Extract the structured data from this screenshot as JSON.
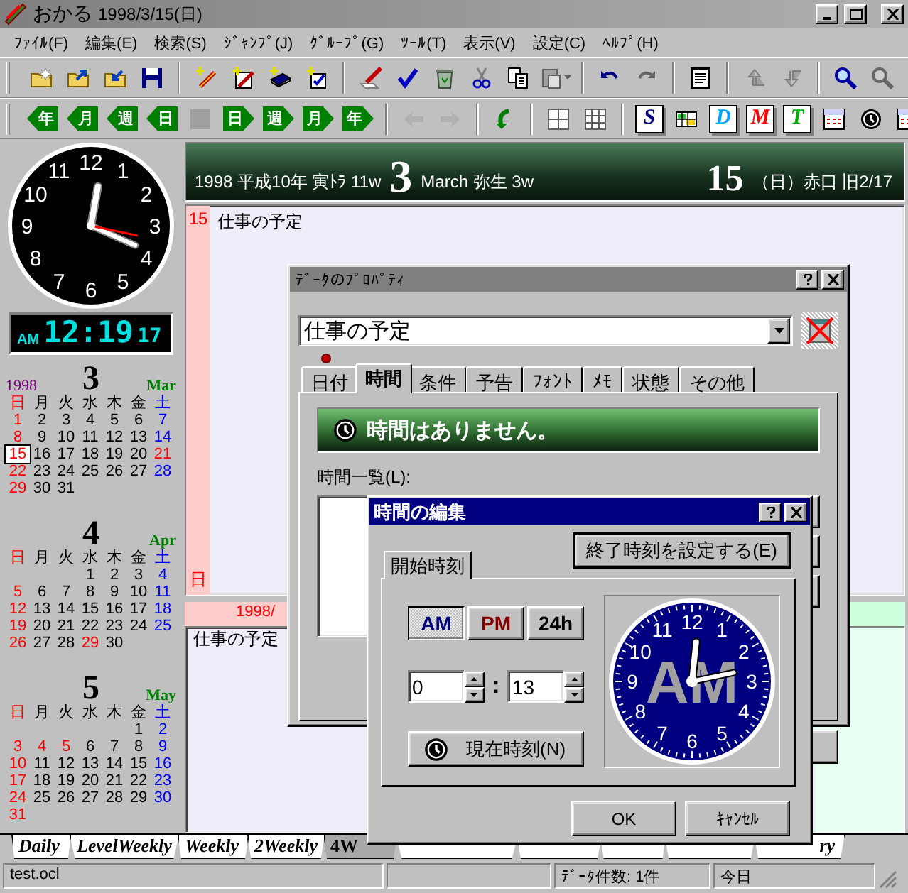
{
  "window": {
    "app_name": "おかる",
    "title_date": "1998/3/15(日)"
  },
  "menu": [
    "ﾌｧｲﾙ(F)",
    "編集(E)",
    "検索(S)",
    "ｼﾞｬﾝﾌﾟ(J)",
    "ｸﾞﾙｰﾌﾟ(G)",
    "ﾂｰﾙ(T)",
    "表示(V)",
    "設定(C)",
    "ﾍﾙﾌﾟ(H)"
  ],
  "toolbar_1": [
    [
      {
        "kind": "folder-new",
        "disabled": false
      },
      {
        "kind": "folder-open",
        "disabled": false
      },
      {
        "kind": "folder-save",
        "disabled": false
      },
      {
        "kind": "disk",
        "disabled": false
      }
    ],
    [
      {
        "kind": "new-pen",
        "disabled": false
      },
      {
        "kind": "new-edit",
        "disabled": false
      },
      {
        "kind": "new-book",
        "disabled": false
      },
      {
        "kind": "new-check",
        "disabled": false
      }
    ],
    [
      {
        "kind": "pen",
        "disabled": false
      },
      {
        "kind": "check",
        "disabled": false
      },
      {
        "kind": "trash",
        "disabled": false
      },
      {
        "kind": "scissors",
        "disabled": false
      },
      {
        "kind": "copy",
        "disabled": false
      },
      {
        "kind": "paste",
        "disabled": true
      }
    ],
    [
      {
        "kind": "undo",
        "disabled": false
      },
      {
        "kind": "redo",
        "disabled": true
      }
    ],
    [
      {
        "kind": "note",
        "disabled": false
      }
    ],
    [
      {
        "kind": "up",
        "disabled": true
      },
      {
        "kind": "down",
        "disabled": true
      }
    ],
    [
      {
        "kind": "search",
        "disabled": false
      },
      {
        "kind": "search",
        "disabled": true
      }
    ]
  ],
  "toolbar_2": [
    [
      {
        "kind": "prev",
        "label": "年",
        "disabled": false
      },
      {
        "kind": "prev",
        "label": "月",
        "disabled": false
      },
      {
        "kind": "prev",
        "label": "週",
        "disabled": false
      },
      {
        "kind": "prev",
        "label": "日",
        "disabled": false
      },
      {
        "kind": "stop",
        "disabled": true
      },
      {
        "kind": "next",
        "label": "日",
        "disabled": false
      },
      {
        "kind": "next",
        "label": "週",
        "disabled": false
      },
      {
        "kind": "next",
        "label": "月",
        "disabled": false
      },
      {
        "kind": "next",
        "label": "年",
        "disabled": false
      }
    ],
    [
      {
        "kind": "back",
        "disabled": true
      },
      {
        "kind": "forward",
        "disabled": true
      }
    ],
    [
      {
        "kind": "refresh",
        "disabled": false
      }
    ],
    [
      {
        "kind": "grid4",
        "disabled": false
      },
      {
        "kind": "grid9",
        "disabled": false
      }
    ],
    [
      {
        "kind": "letter",
        "label": "S",
        "color": "#000080",
        "disabled": false
      },
      {
        "kind": "table",
        "disabled": false
      },
      {
        "kind": "letter",
        "label": "D",
        "color": "#00a0ff",
        "disabled": false
      },
      {
        "kind": "letter",
        "label": "M",
        "color": "#ff0000",
        "disabled": false
      },
      {
        "kind": "letter",
        "label": "T",
        "color": "#00b000",
        "disabled": false
      },
      {
        "kind": "calendar",
        "disabled": false
      },
      {
        "kind": "clock",
        "disabled": false
      },
      {
        "kind": "calendar",
        "disabled": false
      }
    ]
  ],
  "clock": {
    "dial": [
      "12",
      "11",
      "1",
      "10",
      "2",
      "9",
      "3",
      "8",
      "4",
      "7",
      "5",
      "6"
    ],
    "meridiem": "AM",
    "time": "12:19",
    "seconds": "17"
  },
  "calendars": [
    {
      "year": "1998",
      "month": "3",
      "month_abbr": "Mar",
      "weekdays": [
        "日",
        "月",
        "火",
        "水",
        "木",
        "金",
        "土"
      ],
      "weeks": [
        [
          {
            "t": "1",
            "kind": "sunday",
            "selected": false
          },
          {
            "t": "2",
            "kind": "weekday",
            "selected": false
          },
          {
            "t": "3",
            "kind": "weekday",
            "selected": false
          },
          {
            "t": "4",
            "kind": "weekday",
            "selected": false
          },
          {
            "t": "5",
            "kind": "weekday",
            "selected": false
          },
          {
            "t": "6",
            "kind": "weekday",
            "selected": false
          },
          {
            "t": "7",
            "kind": "saturday",
            "selected": false
          }
        ],
        [
          {
            "t": "8",
            "kind": "sunday",
            "selected": false
          },
          {
            "t": "9",
            "kind": "weekday",
            "selected": false
          },
          {
            "t": "10",
            "kind": "weekday",
            "selected": false
          },
          {
            "t": "11",
            "kind": "weekday",
            "selected": false
          },
          {
            "t": "12",
            "kind": "weekday",
            "selected": false
          },
          {
            "t": "13",
            "kind": "weekday",
            "selected": false
          },
          {
            "t": "14",
            "kind": "saturday",
            "selected": false
          }
        ],
        [
          {
            "t": "15",
            "kind": "sunday",
            "selected": true
          },
          {
            "t": "16",
            "kind": "weekday",
            "selected": false
          },
          {
            "t": "17",
            "kind": "weekday",
            "selected": false
          },
          {
            "t": "18",
            "kind": "weekday",
            "selected": false
          },
          {
            "t": "19",
            "kind": "weekday",
            "selected": false
          },
          {
            "t": "20",
            "kind": "weekday",
            "selected": false
          },
          {
            "t": "21",
            "kind": "holiday",
            "selected": false
          }
        ],
        [
          {
            "t": "22",
            "kind": "sunday",
            "selected": false
          },
          {
            "t": "23",
            "kind": "weekday",
            "selected": false
          },
          {
            "t": "24",
            "kind": "weekday",
            "selected": false
          },
          {
            "t": "25",
            "kind": "weekday",
            "selected": false
          },
          {
            "t": "26",
            "kind": "weekday",
            "selected": false
          },
          {
            "t": "27",
            "kind": "weekday",
            "selected": false
          },
          {
            "t": "28",
            "kind": "saturday",
            "selected": false
          }
        ],
        [
          {
            "t": "29",
            "kind": "sunday",
            "selected": false
          },
          {
            "t": "30",
            "kind": "weekday",
            "selected": false
          },
          {
            "t": "31",
            "kind": "weekday",
            "selected": false
          }
        ]
      ]
    },
    {
      "month": "4",
      "month_abbr": "Apr",
      "weekdays": [
        "日",
        "月",
        "火",
        "水",
        "木",
        "金",
        "土"
      ],
      "weeks": [
        [
          {
            "t": "1",
            "kind": "weekday",
            "selected": false
          },
          {
            "t": "2",
            "kind": "weekday",
            "selected": false
          },
          {
            "t": "3",
            "kind": "weekday",
            "selected": false
          },
          {
            "t": "4",
            "kind": "saturday",
            "selected": false
          }
        ],
        [
          {
            "t": "5",
            "kind": "sunday",
            "selected": false
          },
          {
            "t": "6",
            "kind": "weekday",
            "selected": false
          },
          {
            "t": "7",
            "kind": "weekday",
            "selected": false
          },
          {
            "t": "8",
            "kind": "weekday",
            "selected": false
          },
          {
            "t": "9",
            "kind": "weekday",
            "selected": false
          },
          {
            "t": "10",
            "kind": "weekday",
            "selected": false
          },
          {
            "t": "11",
            "kind": "saturday",
            "selected": false
          }
        ],
        [
          {
            "t": "12",
            "kind": "sunday",
            "selected": false
          },
          {
            "t": "13",
            "kind": "weekday",
            "selected": false
          },
          {
            "t": "14",
            "kind": "weekday",
            "selected": false
          },
          {
            "t": "15",
            "kind": "weekday",
            "selected": false
          },
          {
            "t": "16",
            "kind": "weekday",
            "selected": false
          },
          {
            "t": "17",
            "kind": "weekday",
            "selected": false
          },
          {
            "t": "18",
            "kind": "saturday",
            "selected": false
          }
        ],
        [
          {
            "t": "19",
            "kind": "sunday",
            "selected": false
          },
          {
            "t": "20",
            "kind": "weekday",
            "selected": false
          },
          {
            "t": "21",
            "kind": "weekday",
            "selected": false
          },
          {
            "t": "22",
            "kind": "weekday",
            "selected": false
          },
          {
            "t": "23",
            "kind": "weekday",
            "selected": false
          },
          {
            "t": "24",
            "kind": "weekday",
            "selected": false
          },
          {
            "t": "25",
            "kind": "saturday",
            "selected": false
          }
        ],
        [
          {
            "t": "26",
            "kind": "sunday",
            "selected": false
          },
          {
            "t": "27",
            "kind": "weekday",
            "selected": false
          },
          {
            "t": "28",
            "kind": "weekday",
            "selected": false
          },
          {
            "t": "29",
            "kind": "holiday",
            "selected": false
          },
          {
            "t": "30",
            "kind": "weekday",
            "selected": false
          }
        ]
      ]
    },
    {
      "month": "5",
      "month_abbr": "May",
      "weekdays": [
        "日",
        "月",
        "火",
        "水",
        "木",
        "金",
        "土"
      ],
      "weeks": [
        [
          {
            "t": "1",
            "kind": "weekday",
            "selected": false
          },
          {
            "t": "2",
            "kind": "saturday",
            "selected": false
          }
        ],
        [
          {
            "t": "3",
            "kind": "sunday",
            "selected": false
          },
          {
            "t": "4",
            "kind": "holiday",
            "selected": false
          },
          {
            "t": "5",
            "kind": "holiday",
            "selected": false
          },
          {
            "t": "6",
            "kind": "weekday",
            "selected": false
          },
          {
            "t": "7",
            "kind": "weekday",
            "selected": false
          },
          {
            "t": "8",
            "kind": "weekday",
            "selected": false
          },
          {
            "t": "9",
            "kind": "saturday",
            "selected": false
          }
        ],
        [
          {
            "t": "10",
            "kind": "sunday",
            "selected": false
          },
          {
            "t": "11",
            "kind": "weekday",
            "selected": false
          },
          {
            "t": "12",
            "kind": "weekday",
            "selected": false
          },
          {
            "t": "13",
            "kind": "weekday",
            "selected": false
          },
          {
            "t": "14",
            "kind": "weekday",
            "selected": false
          },
          {
            "t": "15",
            "kind": "weekday",
            "selected": false
          },
          {
            "t": "16",
            "kind": "saturday",
            "selected": false
          }
        ],
        [
          {
            "t": "17",
            "kind": "sunday",
            "selected": false
          },
          {
            "t": "18",
            "kind": "weekday",
            "selected": false
          },
          {
            "t": "19",
            "kind": "weekday",
            "selected": false
          },
          {
            "t": "20",
            "kind": "weekday",
            "selected": false
          },
          {
            "t": "21",
            "kind": "weekday",
            "selected": false
          },
          {
            "t": "22",
            "kind": "weekday",
            "selected": false
          },
          {
            "t": "23",
            "kind": "saturday",
            "selected": false
          }
        ],
        [
          {
            "t": "24",
            "kind": "sunday",
            "selected": false
          },
          {
            "t": "25",
            "kind": "weekday",
            "selected": false
          },
          {
            "t": "26",
            "kind": "weekday",
            "selected": false
          },
          {
            "t": "27",
            "kind": "weekday",
            "selected": false
          },
          {
            "t": "28",
            "kind": "weekday",
            "selected": false
          },
          {
            "t": "29",
            "kind": "weekday",
            "selected": false
          },
          {
            "t": "30",
            "kind": "saturday",
            "selected": false
          }
        ],
        [
          {
            "t": "31",
            "kind": "sunday",
            "selected": false
          }
        ]
      ]
    }
  ],
  "header": {
    "left": "1998 平成10年 寅ﾄﾗ 11w",
    "month": "3",
    "month_info": "March 弥生 3w",
    "day": "15",
    "day_info": "（日）赤口 旧2/17"
  },
  "day_pane": {
    "day": "15",
    "weekday": "日",
    "entry": "仕事の予定"
  },
  "list_pane": {
    "header": "1998/",
    "entry": "仕事の予定"
  },
  "view_tabs": [
    {
      "label": "Daily",
      "selected": false
    },
    {
      "label": "LevelWeekly",
      "selected": false
    },
    {
      "label": "Weekly",
      "selected": false
    },
    {
      "label": "2Weekly",
      "selected": false
    },
    {
      "label": "4W",
      "selected": true
    },
    {
      "selected": false
    },
    {
      "selected": false
    },
    {
      "selected": false
    },
    {
      "selected": false
    },
    {
      "label": "ry",
      "selected": false
    }
  ],
  "status_bar": {
    "file": "test.ocl",
    "count": "ﾃﾞｰﾀ件数: 1件",
    "date_mode": "今日"
  },
  "property_dialog": {
    "title": "ﾃﾞｰﾀのﾌﾟﾛﾊﾟﾃｨ",
    "name": "仕事の予定",
    "tabs": [
      {
        "label": "日付",
        "selected": false
      },
      {
        "label": "時間",
        "selected": true
      },
      {
        "label": "条件",
        "selected": false
      },
      {
        "label": "予告",
        "selected": false
      },
      {
        "label": "ﾌｫﾝﾄ",
        "selected": false
      },
      {
        "label": "ﾒﾓ",
        "selected": false
      },
      {
        "label": "状態",
        "selected": false
      },
      {
        "label": "その他",
        "selected": false
      }
    ],
    "banner": "時間はありません。",
    "list_label": "時間一覧(L):"
  },
  "time_dialog": {
    "title": "時間の編集",
    "end_button": "終了時刻を設定する(E)",
    "tab": "開始時刻",
    "modes": [
      {
        "label": "AM",
        "selected": true,
        "color": "#000080"
      },
      {
        "label": "PM",
        "selected": false,
        "color": "#800000"
      },
      {
        "label": "24h",
        "selected": false,
        "color": "#000000"
      }
    ],
    "hour": "0",
    "separator": ":",
    "minute": "13",
    "now_button": "現在時刻(N)",
    "clock": {
      "dial": [
        "12",
        "11",
        "1",
        "10",
        "2",
        "9",
        "3",
        "8",
        "4",
        "7",
        "5",
        "6"
      ],
      "label": "AM"
    },
    "buttons": [
      "OK",
      "ｷｬﾝｾﾙ"
    ]
  }
}
